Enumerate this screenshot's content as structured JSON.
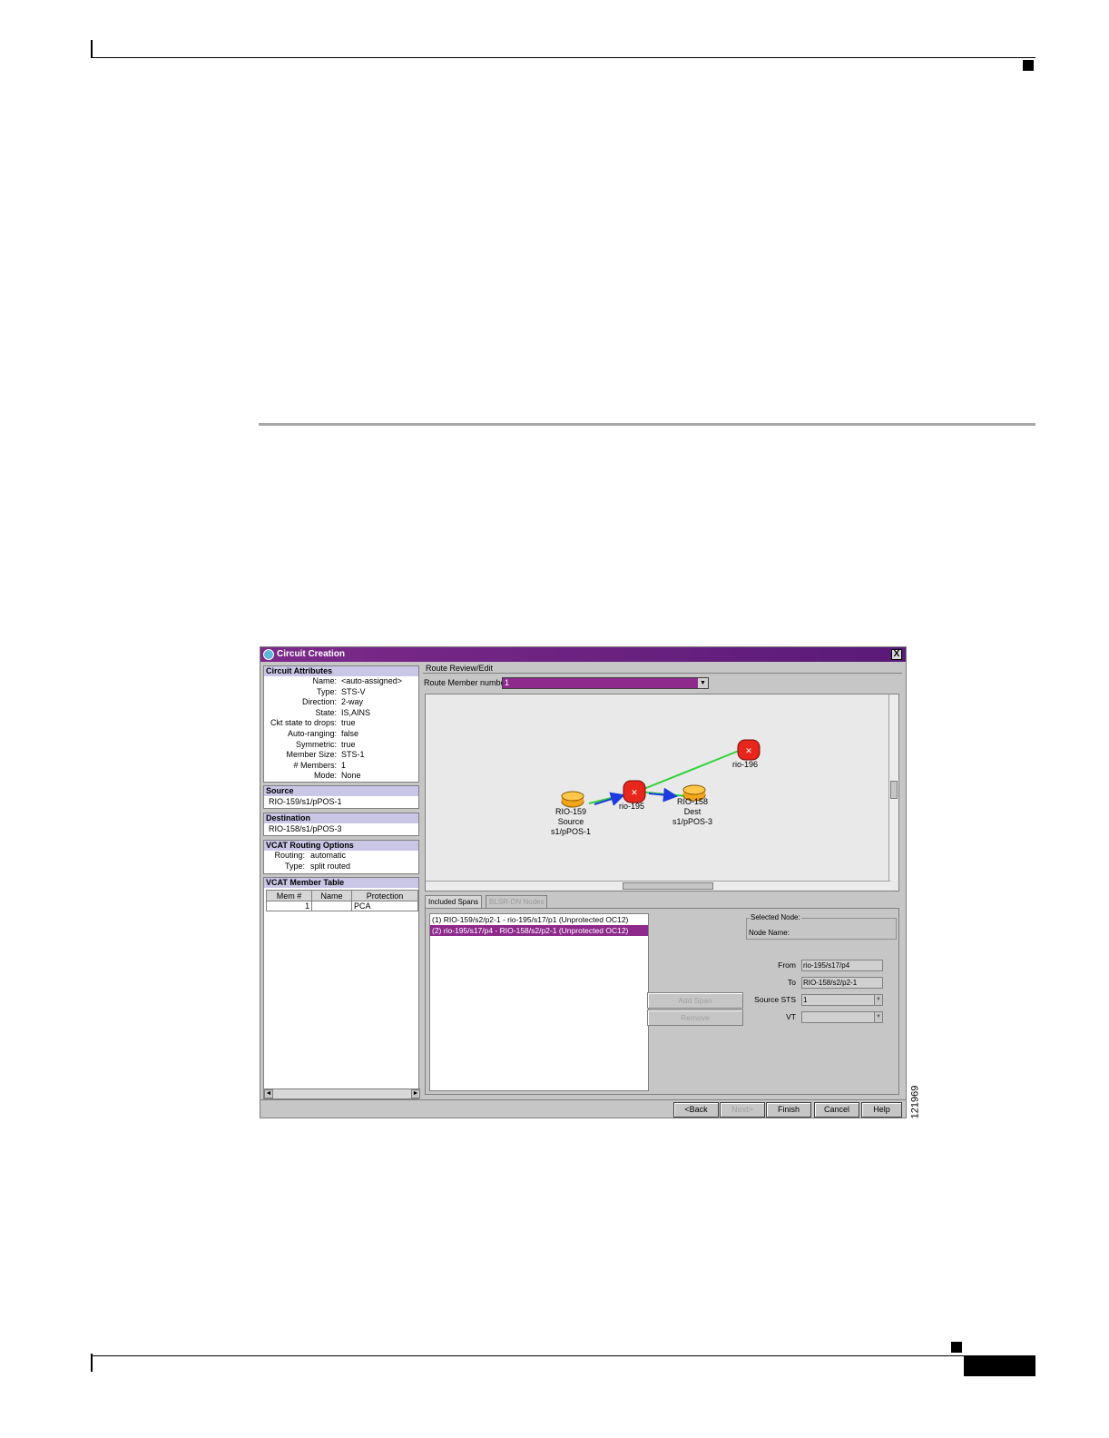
{
  "figure_id": "121969",
  "window": {
    "title": "Circuit Creation",
    "close_label": "X"
  },
  "circuit_attributes": {
    "heading": "Circuit Attributes",
    "rows": [
      {
        "key": "Name:",
        "value": "<auto-assigned>"
      },
      {
        "key": "Type:",
        "value": "STS-V"
      },
      {
        "key": "Direction:",
        "value": "2-way"
      },
      {
        "key": "State:",
        "value": "IS,AINS"
      },
      {
        "key": "Ckt state to drops:",
        "value": "true"
      },
      {
        "key": "Auto-ranging:",
        "value": "false"
      },
      {
        "key": "Symmetric:",
        "value": "true"
      },
      {
        "key": "Member Size:",
        "value": "STS-1"
      },
      {
        "key": "# Members:",
        "value": "1"
      },
      {
        "key": "Mode:",
        "value": "None"
      }
    ]
  },
  "source": {
    "heading": "Source",
    "value": "RIO-159/s1/pPOS-1"
  },
  "destination": {
    "heading": "Destination",
    "value": "RIO-158/s1/pPOS-3"
  },
  "vcat_routing": {
    "heading": "VCAT Routing Options",
    "rows": [
      {
        "key": "Routing:",
        "value": "automatic"
      },
      {
        "key": "Type:",
        "value": "split routed"
      }
    ]
  },
  "member_table": {
    "heading": "VCAT Member Table",
    "columns": [
      "Mem #",
      "Name",
      "Protection"
    ],
    "rows": [
      [
        "1",
        "",
        "PCA"
      ]
    ]
  },
  "route_review": {
    "heading": "Route Review/Edit",
    "member_label": "Route Member number:",
    "member_value": "1"
  },
  "map": {
    "nodes": [
      {
        "id": "rio-196",
        "lines": [
          "rio-196"
        ]
      },
      {
        "id": "rio-195",
        "lines": [
          "rio-195"
        ]
      },
      {
        "id": "RIO-159",
        "lines": [
          "RIO-159",
          "Source",
          "s1/pPOS-1"
        ]
      },
      {
        "id": "RIO-158",
        "lines": [
          "RIO-158",
          "Dest",
          "s1/pPOS-3"
        ]
      }
    ],
    "link_colors": {
      "green": "#2fd23a",
      "blue": "#1f3be0"
    }
  },
  "tabs": [
    {
      "label": "Included Spans",
      "active": true
    },
    {
      "label": "BLSR-DN Nodes",
      "active": false
    }
  ],
  "spans": [
    {
      "text": "(1) RIO-159/s2/p2-1 - rio-195/s17/p1 (Unprotected OC12)",
      "selected": false
    },
    {
      "text": "(2) rio-195/s17/p4 - RIO-158/s2/p2-1 (Unprotected OC12)",
      "selected": true
    }
  ],
  "selected_node": {
    "title": "Selected Node:",
    "label": "Node Name:"
  },
  "fields": {
    "from_label": "From",
    "from_value": "rio-195/s17/p4",
    "to_label": "To",
    "to_value": "RIO-158/s2/p2-1",
    "source_sts_label": "Source STS",
    "source_sts_value": "1",
    "vt_label": "VT",
    "vt_value": ""
  },
  "span_buttons": {
    "add": "Add Span",
    "remove": "Remove"
  },
  "wizard_buttons": {
    "back": "<Back",
    "next": "Next>",
    "finish": "Finish",
    "cancel": "Cancel",
    "help": "Help"
  }
}
